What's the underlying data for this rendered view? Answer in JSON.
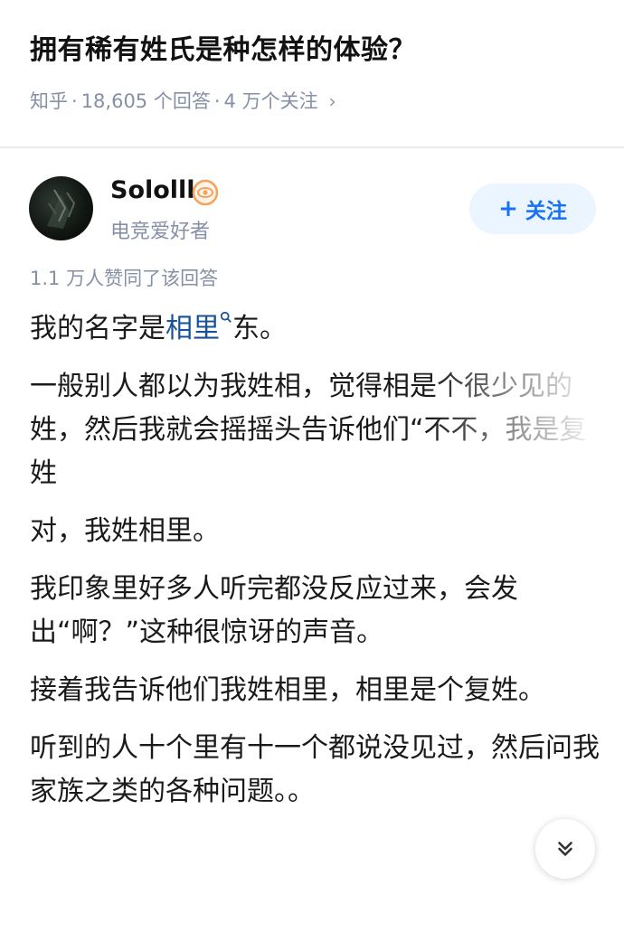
{
  "question": {
    "title": "拥有稀有姓氏是种怎样的体验？",
    "source": "知乎",
    "answers": "18,605 个回答",
    "followers": "4 万个关注"
  },
  "author": {
    "name": "Sololll",
    "bio": "电竞爱好者",
    "follow_label": "关注",
    "follow_plus": "+"
  },
  "answer": {
    "vote_text": "1.1 万人赞同了该回答",
    "p1_pre": "我的名字是",
    "p1_link": "相里",
    "p1_post": "东。",
    "p2": "一般别人都以为我姓相，觉得相是个很少见的姓，然后我就会摇摇头告诉他们“不不，我是复姓",
    "p3": "对，我姓相里。",
    "p4": "我印象里好多人听完都没反应过来，会发出“啊？”这种很惊讶的声音。",
    "p5": "接着我告诉他们我姓相里，相里是个复姓。",
    "p6": "听到的人十个里有十一个都说没见过，然后问我家族之类的各种问题。。"
  },
  "icons": {
    "meta_chevron": "chevron-right-icon",
    "badge": "eye-badge-icon",
    "keyword_search": "search-icon",
    "expand": "chevron-double-down-icon"
  },
  "colors": {
    "link": "#175199",
    "follow_text": "#1772f6",
    "follow_bg": "#ebf5ff",
    "meta": "#8590a6",
    "badge": "#f5a35c"
  }
}
